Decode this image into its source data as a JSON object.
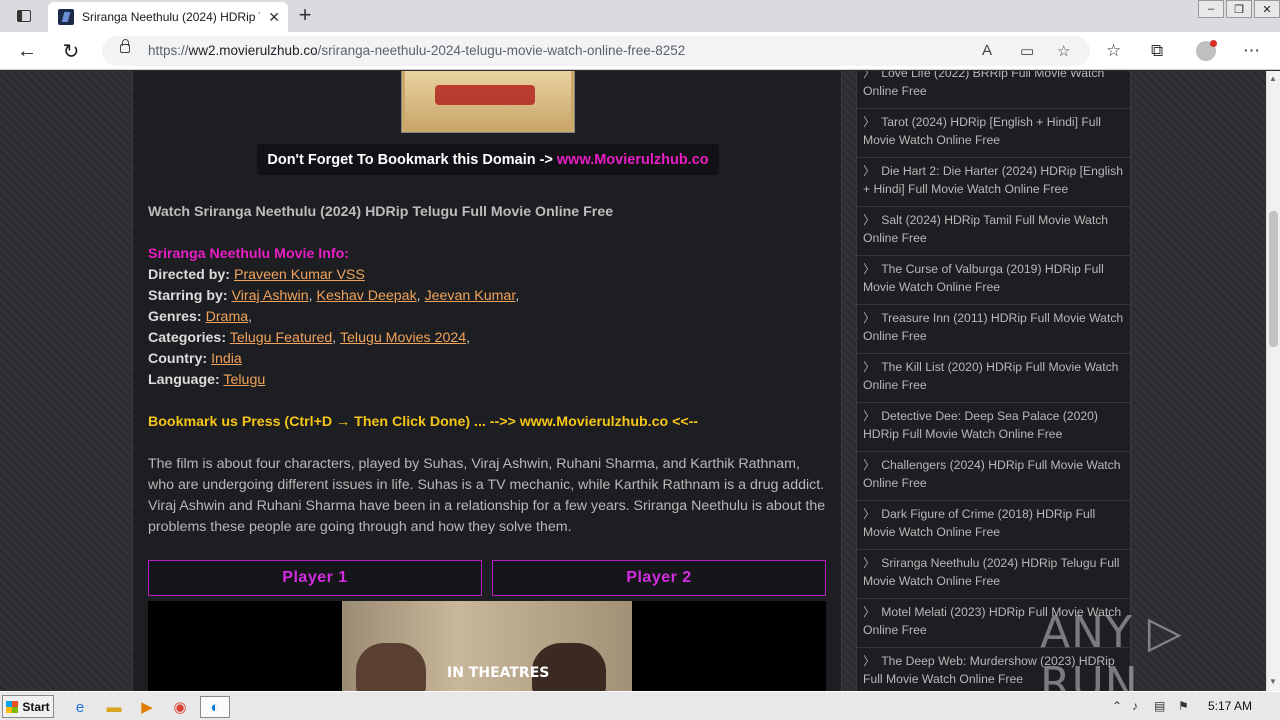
{
  "browser": {
    "tab_title": "Sriranga Neethulu (2024) HDRip T",
    "tab_close": "✕",
    "new_tab": "+",
    "url_prefix": "https://",
    "url_host": "ww2.movierulzhub.co",
    "url_path": "/sriranga-neethulu-2024-telugu-movie-watch-online-free-8252",
    "window_controls": [
      "–",
      "❐",
      "✕"
    ]
  },
  "page": {
    "bookmark_banner_text": "Don't Forget To Bookmark this Domain ->",
    "bookmark_banner_domain": "www.Movierulzhub.co",
    "heading": "Watch Sriranga Neethulu (2024) HDRip Telugu Full Movie Online Free",
    "info_title": "Sriranga Neethulu Movie Info:",
    "directed_label": "Directed by:",
    "director": "Praveen Kumar VSS",
    "starring_label": "Starring by:",
    "cast": [
      "Viraj Ashwin",
      "Keshav Deepak",
      "Jeevan Kumar"
    ],
    "genres_label": "Genres:",
    "genre": "Drama",
    "categories_label": "Categories:",
    "categories": [
      "Telugu Featured",
      "Telugu Movies 2024"
    ],
    "country_label": "Country:",
    "country": "India",
    "language_label": "Language:",
    "language": "Telugu",
    "bookmark_line": "Bookmark us Press (Ctrl+D → Then Click Done) ... -->> www.Movierulzhub.co <<--",
    "synopsis": "The film is about four characters, played by Suhas, Viraj Ashwin, Ruhani Sharma, and Karthik Rathnam, who are undergoing different issues in life. Suhas is a TV mechanic, while Karthik Rathnam is a drug addict. Viraj Ashwin and Ruhani Sharma have been in a relationship for a few years. Sriranga Neethulu is about the problems these people are going through and how they solve them.",
    "player1": "Player 1",
    "player2": "Player 2",
    "poster_tag": "IN THEATRES"
  },
  "sidebar": {
    "items": [
      {
        "line1": "Love Life (2022) BRRip Full Movie Watch",
        "line2": "Online Free"
      },
      {
        "line1": "Tarot (2024) HDRip [English + Hindi] Full",
        "line2": "Movie Watch Online Free"
      },
      {
        "line1": "Die Hart 2: Die Harter (2024) HDRip [English",
        "line2": "+ Hindi] Full Movie Watch Online Free"
      },
      {
        "line1": "Salt (2024) HDRip Tamil Full Movie Watch",
        "line2": "Online Free"
      },
      {
        "line1": "The Curse of Valburga (2019) HDRip Full",
        "line2": "Movie Watch Online Free"
      },
      {
        "line1": "Treasure Inn (2011) HDRip Full Movie Watch",
        "line2": "Online Free"
      },
      {
        "line1": "The Kill List (2020) HDRip Full Movie Watch",
        "line2": "Online Free"
      },
      {
        "line1": "Detective Dee: Deep Sea Palace (2020)",
        "line2": "HDRip Full Movie Watch Online Free"
      },
      {
        "line1": "Challengers (2024) HDRip Full Movie Watch",
        "line2": "Online Free"
      },
      {
        "line1": "Dark Figure of Crime (2018) HDRip Full",
        "line2": "Movie Watch Online Free"
      },
      {
        "line1": "Sriranga Neethulu (2024) HDRip Telugu Full",
        "line2": "Movie Watch Online Free"
      },
      {
        "line1": "Motel Melati (2023) HDRip Full Movie Watch",
        "line2": "Online Free"
      },
      {
        "line1": "The Deep Web: Murdershow (2023) HDRip",
        "line2": "Full Movie Watch Online Free"
      }
    ]
  },
  "watermark": "ANY ▷ RUN",
  "taskbar": {
    "start_label": "Start",
    "clock": "5:17 AM"
  }
}
